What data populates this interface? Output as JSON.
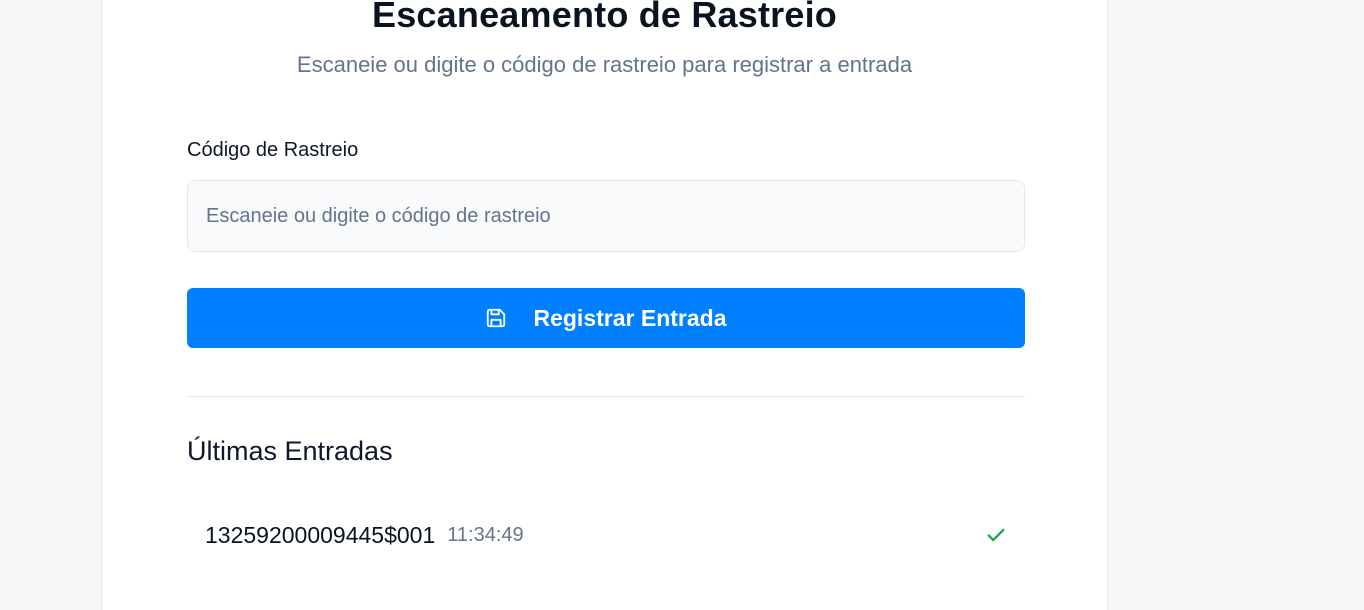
{
  "header": {
    "title": "Escaneamento de Rastreio",
    "subtitle": "Escaneie ou digite o código de rastreio para registrar a entrada"
  },
  "form": {
    "label": "Código de Rastreio",
    "placeholder": "Escaneie ou digite o código de rastreio",
    "value": "",
    "button_label": "Registrar Entrada",
    "button_icon": "save-icon",
    "accent": "#0080ff"
  },
  "recent": {
    "title": "Últimas Entradas",
    "items": [
      {
        "code": "13259200009445$001",
        "time": "11:34:49",
        "status_icon": "check-icon",
        "status_color": "#16a34a"
      }
    ]
  }
}
